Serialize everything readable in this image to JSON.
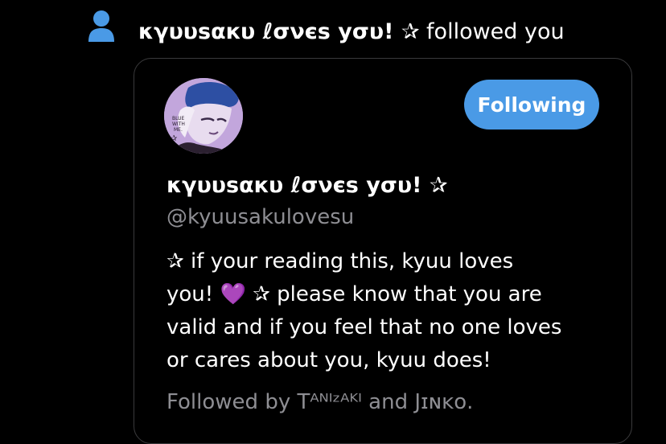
{
  "notification": {
    "icon": "person-icon",
    "actor_name": "κγυυѕαкυ ℓσνєѕ уσυ! ✰",
    "action_text": "followed you"
  },
  "profile_card": {
    "avatar_icon": "profile-avatar",
    "follow_button_label": "Following",
    "display_name": "κγυυѕαкυ ℓσνєѕ уσυ! ✰",
    "handle": "@kyuusakulovesu",
    "bio_lines": [
      "✰ if your reading this, kyuu loves",
      "you! 💜  ✰ please know that you are",
      "valid and if you feel that no one loves",
      "or cares about you, kyuu does!"
    ],
    "followed_by": "Followed by Tᴬᴺᴵᶻᴬᴷᴵ and Jɪɴᴋᴏ."
  },
  "colors": {
    "background": "#000000",
    "accent": "#4a9ae6",
    "secondary_text": "#8e8e93",
    "card_border": "#3a3a3c"
  }
}
